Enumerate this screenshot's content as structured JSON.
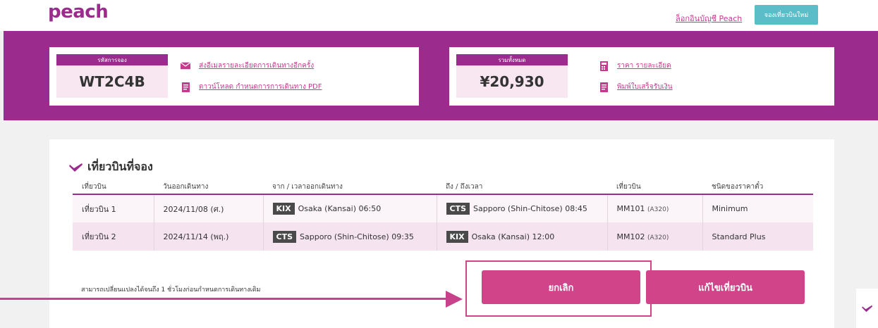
{
  "header": {
    "logo": "peach",
    "login_link": "ล็อกอินบัญชี Peach",
    "new_booking_button": "จองเที่ยวบินใหม่"
  },
  "summary": {
    "booking_code_label": "รหัสการจอง",
    "booking_code": "WT2C4B",
    "resend_email": "ส่งอีเมลรายละเอียดการเดินทางอีกครั้ง",
    "download_pdf": "ดาวน์โหลด กำหนดการการเดินทาง PDF",
    "total_label": "รวมทั้งหมด",
    "total_amount": "¥20,930",
    "price_details": "ราคา รายละเอียด",
    "print_receipt": "พิมพ์ใบเสร็จรับเงิน"
  },
  "flights": {
    "title": "เที่ยวบินที่จอง",
    "headers": [
      "เที่ยวบิน",
      "วันออกเดินทาง",
      "จาก / เวลาออกเดินทาง",
      "ถึง / ถึงเวลา",
      "เที่ยวบิน",
      "ชนิดของราคาตั๋ว"
    ],
    "rows": [
      {
        "flight": "เที่ยวบิน 1",
        "date": "2024/11/08 (ศ.)",
        "from_code": "KIX",
        "from": "Osaka (Kansai) 06:50",
        "to_code": "CTS",
        "to": "Sapporo (Shin-Chitose) 08:45",
        "flight_no": "MM101",
        "aircraft": "(A320)",
        "fare": "Minimum"
      },
      {
        "flight": "เที่ยวบิน 2",
        "date": "2024/11/14 (พฤ.)",
        "from_code": "CTS",
        "from": "Sapporo (Shin-Chitose) 09:35",
        "to_code": "KIX",
        "to": "Osaka (Kansai) 12:00",
        "flight_no": "MM102",
        "aircraft": "(A320)",
        "fare": "Standard Plus"
      }
    ]
  },
  "actions": {
    "notice": "สามารถเปลี่ยนแปลงได้จนถึง 1 ชั่วโมงก่อนกำหนดการเดินทางเดิม",
    "cancel": "ยกเลิก",
    "modify": "แก้ไขเที่ยวบิน"
  },
  "colors": {
    "brand_purple": "#9b2c8d",
    "brand_pink": "#d2448a",
    "teal": "#5bbdc7"
  }
}
